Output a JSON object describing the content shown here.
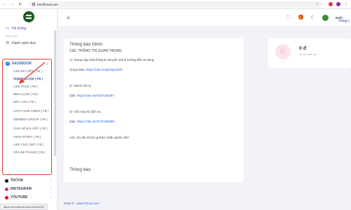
{
  "browser": {
    "url": "rent.flmua.com"
  },
  "sidebar": {
    "items": [
      {
        "label": "Hệ thống"
      },
      {
        "label": "Danh sách đơn"
      }
    ],
    "section": "Dịch vụ",
    "facebook": {
      "label": "FACEBOOK",
      "subitems": [
        "LIKE BÀI VIẾT ( FB )",
        "SUB/FOLLOW ( FB )",
        "LIKE PAGE ( FB )",
        "BÌNH LUẬN ( FB )",
        "MẮT LIVE ( FB )",
        "LƯỢT XEM VIDEO ( FB )",
        "MEMBER GROUP ( FB )",
        "CHIA SẺ BÀI VIẾT ( FB )",
        "VIEW STORY ( FB )",
        "LIKE CHO CMT ( FB )",
        "VIPLIKE THÁNG ( FB )"
      ]
    },
    "groups": [
      "TIKTOK",
      "INSTAGRAM",
      "YOUTUBE"
    ],
    "status_url": "https://rent.flmua.com/vi/en/1919"
  },
  "topbar": {
    "username": "Noih",
    "tab_right": "Trang c"
  },
  "pinned": {
    "title": "Thông báo Ghim",
    "subtitle": "CÁC THÔNG TIN QUAN TRỌNG",
    "line1": "1/- Group cập nhật thông tin khuyến mãi & hướng dẫn sử dụng",
    "group_label": "Group Zalo: ",
    "group_link": "https://zalo.me/g/mlpwr826",
    "line2": "2/- Admin hỗ trợ",
    "zalo1_label": "Zalo: ",
    "zalo1_link": "https://zalo.me/0367453397",
    "line3": "3/- Cần mua hộ dịch vụ",
    "zalo2_label": "Zalo: ",
    "zalo2_link": "https://zalo.me/0767505858",
    "closing": "Anh, chị cần hỗ trợ gì thêm nhắn admin nhé!"
  },
  "notif": {
    "title": "Thông báo"
  },
  "balance": {
    "amount": "0 đ",
    "label": "Số dư hiện tại"
  },
  "footer": {
    "prefix": "2026 © - ",
    "link": "www.flmua.com"
  }
}
